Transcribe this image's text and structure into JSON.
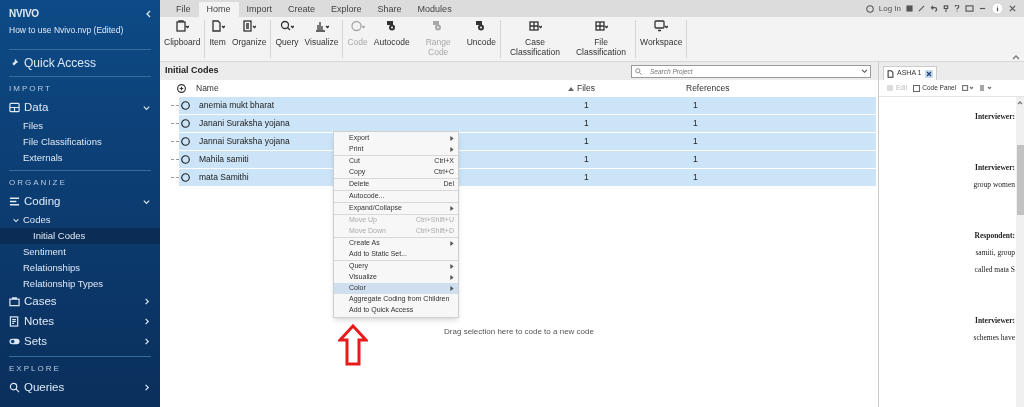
{
  "sidebar": {
    "app_name": "NVIVO",
    "project": "How to use Nvivo.nvp (Edited)",
    "quick_access": "Quick Access",
    "sections": [
      {
        "heading": "IMPORT",
        "groups": [
          {
            "label": "Data",
            "expanded": true,
            "children": [
              {
                "label": "Files",
                "selected": false
              },
              {
                "label": "File Classifications",
                "selected": false
              },
              {
                "label": "Externals",
                "selected": false
              }
            ]
          }
        ]
      },
      {
        "heading": "ORGANIZE",
        "groups": [
          {
            "label": "Coding",
            "expanded": true,
            "children": [
              {
                "label": "Codes",
                "selected": false,
                "children": [
                  {
                    "label": "Initial Codes",
                    "selected": true
                  }
                ]
              },
              {
                "label": "Sentiment",
                "selected": false
              },
              {
                "label": "Relationships",
                "selected": false
              },
              {
                "label": "Relationship Types",
                "selected": false
              }
            ]
          },
          {
            "label": "Cases",
            "expanded": false
          },
          {
            "label": "Notes",
            "expanded": false
          },
          {
            "label": "Sets",
            "expanded": false
          }
        ]
      },
      {
        "heading": "EXPLORE",
        "groups": [
          {
            "label": "Queries",
            "expanded": false
          }
        ]
      }
    ]
  },
  "menu_tabs": [
    {
      "label": "File",
      "selected": false
    },
    {
      "label": "Home",
      "selected": true
    },
    {
      "label": "Import",
      "selected": false
    },
    {
      "label": "Create",
      "selected": false
    },
    {
      "label": "Explore",
      "selected": false
    },
    {
      "label": "Share",
      "selected": false
    },
    {
      "label": "Modules",
      "selected": false
    }
  ],
  "login": "Log In",
  "ribbon": [
    [
      {
        "label": "Clipboard",
        "disabled": false
      }
    ],
    [
      {
        "label": "Item",
        "disabled": false
      },
      {
        "label": "Organize",
        "disabled": false
      }
    ],
    [
      {
        "label": "Query",
        "disabled": false
      },
      {
        "label": "Visualize",
        "disabled": false
      }
    ],
    [
      {
        "label": "Code",
        "disabled": true
      },
      {
        "label": "Autocode",
        "disabled": false
      },
      {
        "label": "Range Code",
        "disabled": true
      },
      {
        "label": "Uncode",
        "disabled": false
      }
    ],
    [
      {
        "label": "Case Classification",
        "disabled": false
      },
      {
        "label": "File Classification",
        "disabled": false
      }
    ],
    [
      {
        "label": "Workspace",
        "disabled": false
      }
    ]
  ],
  "list": {
    "title": "Initial Codes",
    "search": {
      "placeholder": "Search Project"
    },
    "columns": [
      "Name",
      "Files",
      "References"
    ],
    "rows": [
      {
        "name": "anemia mukt bharat",
        "files": "1",
        "references": "1",
        "selected": true
      },
      {
        "name": "Janani Suraksha yojana",
        "files": "1",
        "references": "1",
        "selected": true
      },
      {
        "name": "Jannai Suraksha yojana",
        "files": "1",
        "references": "1",
        "selected": true
      },
      {
        "name": "Mahila samiti",
        "files": "1",
        "references": "1",
        "selected": true
      },
      {
        "name": "mata Samithi",
        "files": "1",
        "references": "1",
        "selected": true
      }
    ],
    "drop_hint": "Drag selection here to code to a new code"
  },
  "context_menu": [
    [
      {
        "label": "Export",
        "submenu": true,
        "disabled": false,
        "selected": false
      },
      {
        "label": "Print",
        "submenu": true,
        "disabled": false,
        "selected": false
      }
    ],
    [
      {
        "label": "Cut",
        "shortcut": "Ctrl+X",
        "submenu": false,
        "disabled": false,
        "selected": false
      },
      {
        "label": "Copy",
        "shortcut": "Ctrl+C",
        "submenu": false,
        "disabled": false,
        "selected": false
      }
    ],
    [
      {
        "label": "Delete",
        "shortcut": "Del",
        "submenu": false,
        "disabled": false,
        "selected": false
      }
    ],
    [
      {
        "label": "Autocode...",
        "submenu": false,
        "disabled": false,
        "selected": false
      }
    ],
    [
      {
        "label": "Expand/Collapse",
        "submenu": true,
        "disabled": false,
        "selected": false
      }
    ],
    [
      {
        "label": "Move Up",
        "shortcut": "Ctrl+Shift+U",
        "submenu": false,
        "disabled": true,
        "selected": false
      },
      {
        "label": "Move Down",
        "shortcut": "Ctrl+Shift+D",
        "submenu": false,
        "disabled": true,
        "selected": false
      }
    ],
    [
      {
        "label": "Create As",
        "submenu": true,
        "disabled": false,
        "selected": false
      },
      {
        "label": "Add to Static Set...",
        "submenu": false,
        "disabled": false,
        "selected": false
      }
    ],
    [
      {
        "label": "Query",
        "submenu": true,
        "disabled": false,
        "selected": false
      },
      {
        "label": "Visualize",
        "submenu": true,
        "disabled": false,
        "selected": false
      },
      {
        "label": "Color",
        "submenu": true,
        "disabled": false,
        "selected": true
      },
      {
        "label": "Aggregate Coding from Children",
        "submenu": false,
        "disabled": false,
        "selected": false
      },
      {
        "label": "Add to Quick Access",
        "submenu": false,
        "disabled": false,
        "selected": false
      }
    ]
  ],
  "document": {
    "tab": "ASHA 1",
    "edit": {
      "label": "Edit",
      "disabled": true
    },
    "code_panel": {
      "label": "Code Panel",
      "checked": false
    },
    "paragraphs": [
      {
        "speaker": "Interviewer:"
      },
      {
        "speaker": "Interviewer:",
        "lines": [
          "group women"
        ]
      },
      {
        "speaker": "Respondent:",
        "lines": [
          "samiti, group",
          "called mata S"
        ]
      },
      {
        "speaker": "Interviewer:",
        "lines": [
          "schemes have"
        ]
      }
    ]
  }
}
